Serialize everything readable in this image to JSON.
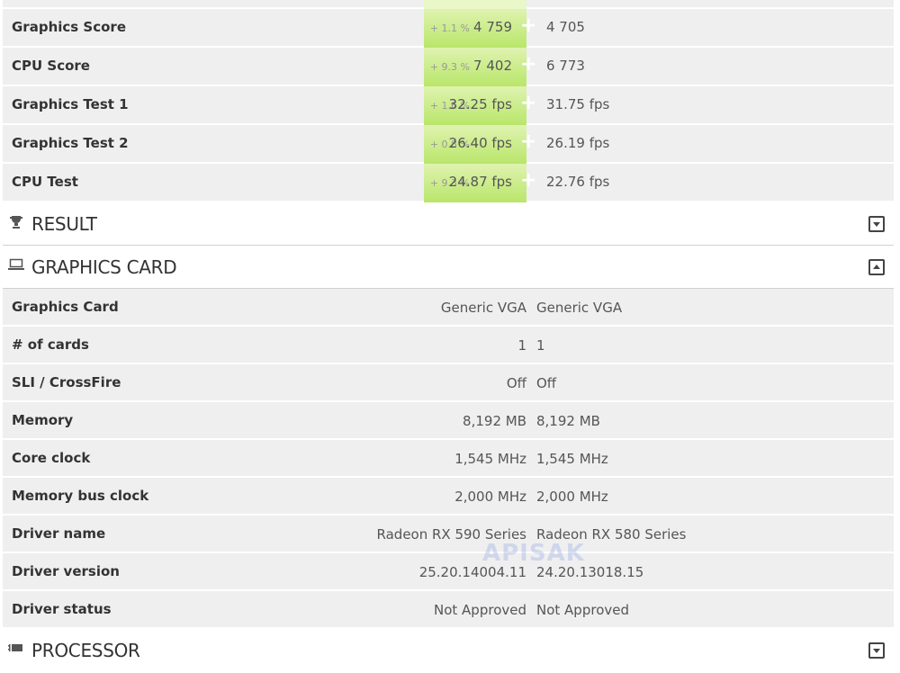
{
  "scores": [
    {
      "label": "Graphics Score",
      "pct": "+ 1.1 %",
      "value1": "4 759",
      "value2": "4 705"
    },
    {
      "label": "CPU Score",
      "pct": "+ 9.3 %",
      "value1": "7 402",
      "value2": "6 773"
    },
    {
      "label": "Graphics Test 1",
      "pct": "+ 1.6 %",
      "value1": "32.25 fps",
      "value2": "31.75 fps"
    },
    {
      "label": "Graphics Test 2",
      "pct": "+ 0.8 %",
      "value1": "26.40 fps",
      "value2": "26.19 fps"
    },
    {
      "label": "CPU Test",
      "pct": "+ 9.3 %",
      "value1": "24.87 fps",
      "value2": "22.76 fps"
    }
  ],
  "plus_glyph": "+",
  "sections": {
    "result": {
      "title": "RESULT",
      "icon": "trophy-icon",
      "state": "collapsed"
    },
    "graphics_card": {
      "title": "GRAPHICS CARD",
      "icon": "laptop-icon",
      "state": "expanded"
    },
    "processor": {
      "title": "PROCESSOR",
      "icon": "cpu-chip-icon",
      "state": "collapsed"
    }
  },
  "graphics_card_rows": [
    {
      "label": "Graphics Card",
      "value1": "Generic VGA",
      "value2": "Generic VGA"
    },
    {
      "label": "# of cards",
      "value1": "1",
      "value2": "1"
    },
    {
      "label": "SLI / CrossFire",
      "value1": "Off",
      "value2": "Off"
    },
    {
      "label": "Memory",
      "value1": "8,192 MB",
      "value2": "8,192 MB"
    },
    {
      "label": "Core clock",
      "value1": "1,545 MHz",
      "value2": "1,545 MHz"
    },
    {
      "label": "Memory bus clock",
      "value1": "2,000 MHz",
      "value2": "2,000 MHz"
    },
    {
      "label": "Driver name",
      "value1": "Radeon RX 590 Series",
      "value2": "Radeon RX 580 Series"
    },
    {
      "label": "Driver version",
      "value1": "25.20.14004.11",
      "value2": "24.20.13018.15"
    },
    {
      "label": "Driver status",
      "value1": "Not Approved",
      "value2": "Not Approved"
    }
  ],
  "watermark": "APISAK",
  "colors": {
    "highlight_top": "#dff3b0",
    "highlight_bottom": "#b9e66a",
    "row_bg": "#efefef"
  }
}
